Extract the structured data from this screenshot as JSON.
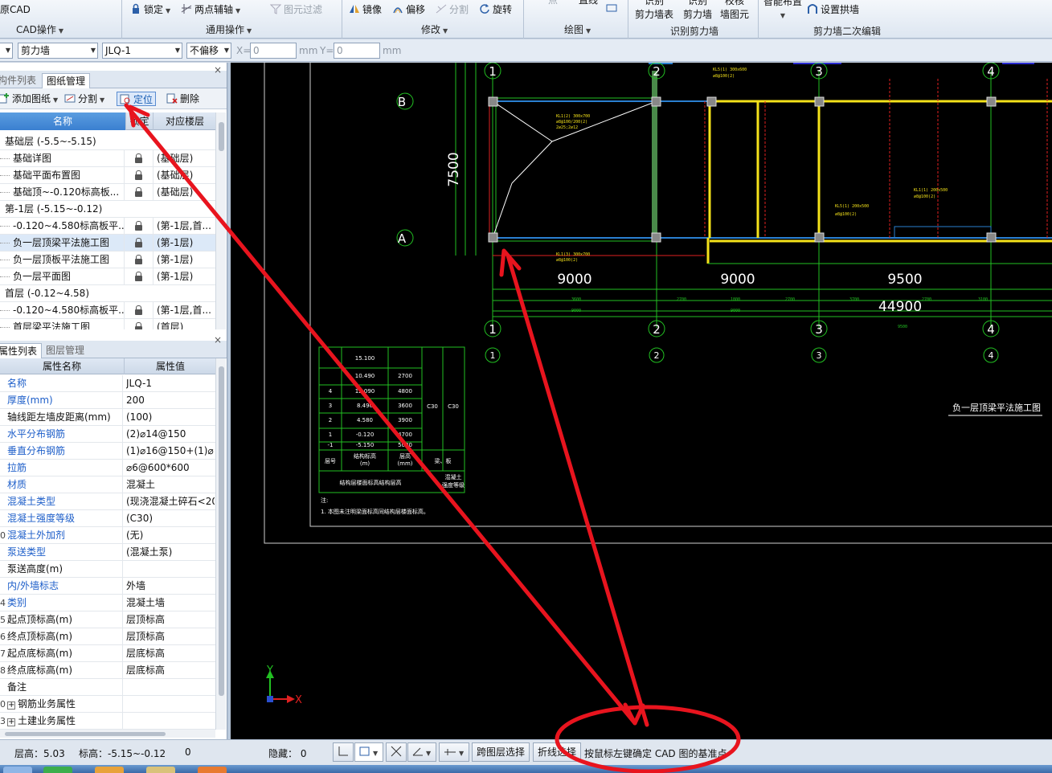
{
  "ribbon": {
    "cad_title": "原CAD",
    "cad_ops": "CAD操作",
    "lock": "锁定",
    "two_point_axis": "两点辅轴",
    "element_filter": "图元过滤",
    "general_ops": "通用操作",
    "mirror": "镜像",
    "offset": "偏移",
    "split": "分割",
    "rotate": "旋转",
    "modify": "修改",
    "point": "点",
    "line": "直线",
    "draw": "绘图",
    "identify_table": "识别\n剪力墙表",
    "identify_wall": "识别\n剪力墙",
    "check_element": "校核\n墙图元",
    "identify_group": "识别剪力墙",
    "smart_layout": "智能布置",
    "set_arch": "设置拱墙",
    "wall_edit": "剪力墙二次编辑"
  },
  "toolbar": {
    "combo0": "",
    "type": "剪力墙",
    "name": "JLQ-1",
    "offset_mode": "不偏移",
    "x_label": "X=",
    "x_value": "0",
    "unit1": "mm",
    "y_label": "Y=",
    "y_value": "0",
    "unit2": "mm"
  },
  "drawing_panel": {
    "tab_components": "构件列表",
    "tab_drawings": "图纸管理",
    "add_drawing": "添加图纸",
    "split": "分割",
    "locate": "定位",
    "delete": "删除",
    "col_name": "名称",
    "col_lock": "锁定",
    "col_floor": "对应楼层",
    "rows": [
      {
        "type": "group",
        "name": "基础层 (-5.5~-5.15)"
      },
      {
        "type": "item",
        "name": "基础详图",
        "floor": "(基础层)"
      },
      {
        "type": "item",
        "name": "基础平面布置图",
        "floor": "(基础层)"
      },
      {
        "type": "item",
        "name": "基础顶~-0.120标高板...",
        "floor": "(基础层)"
      },
      {
        "type": "group",
        "name": "第-1层 (-5.15~-0.12)"
      },
      {
        "type": "item",
        "name": "-0.120~4.580标高板平...",
        "floor": "(第-1层,首..."
      },
      {
        "type": "item",
        "name": "负一层顶梁平法施工图",
        "floor": "(第-1层)"
      },
      {
        "type": "item",
        "name": "负一层顶板平法施工图",
        "floor": "(第-1层)"
      },
      {
        "type": "item",
        "name": "负一层平面图",
        "floor": "(第-1层)"
      },
      {
        "type": "group",
        "name": "首层 (-0.12~4.58)"
      },
      {
        "type": "item",
        "name": "-0.120~4.580标高板平...",
        "floor": "(第-1层,首..."
      },
      {
        "type": "item",
        "name": "首层梁平法施工图",
        "floor": "(首层)"
      }
    ]
  },
  "property_panel": {
    "tab_props": "属性列表",
    "tab_layers": "图层管理",
    "col_name": "属性名称",
    "col_value": "属性值",
    "rows": [
      {
        "idx": "",
        "name": "名称",
        "value": "JLQ-1",
        "blue": true
      },
      {
        "idx": "",
        "name": "厚度(mm)",
        "value": "200",
        "blue": true
      },
      {
        "idx": "",
        "name": "轴线距左墙皮距离(mm)",
        "value": "(100)",
        "blue": false
      },
      {
        "idx": "",
        "name": "水平分布钢筋",
        "value": "(2)⌀14@150",
        "blue": true
      },
      {
        "idx": "",
        "name": "垂直分布钢筋",
        "value": "(1)⌀16@150+(1)⌀",
        "blue": true
      },
      {
        "idx": "",
        "name": "拉筋",
        "value": "⌀6@600*600",
        "blue": true
      },
      {
        "idx": "",
        "name": "材质",
        "value": "混凝土",
        "blue": true
      },
      {
        "idx": "",
        "name": "混凝土类型",
        "value": "(现浇混凝土碎石<20",
        "blue": true
      },
      {
        "idx": "",
        "name": "混凝土强度等级",
        "value": "(C30)",
        "blue": true
      },
      {
        "idx": "0",
        "name": "混凝土外加剂",
        "value": "(无)",
        "blue": true
      },
      {
        "idx": "",
        "name": "泵送类型",
        "value": "(混凝土泵)",
        "blue": true
      },
      {
        "idx": "",
        "name": "泵送高度(m)",
        "value": "",
        "blue": false
      },
      {
        "idx": "",
        "name": "内/外墙标志",
        "value": "外墙",
        "blue": true
      },
      {
        "idx": "4",
        "name": "类别",
        "value": "混凝土墙",
        "blue": true
      },
      {
        "idx": "5",
        "name": "起点顶标高(m)",
        "value": "层顶标高",
        "blue": false
      },
      {
        "idx": "6",
        "name": "终点顶标高(m)",
        "value": "层顶标高",
        "blue": false
      },
      {
        "idx": "7",
        "name": "起点底标高(m)",
        "value": "层底标高",
        "blue": false
      },
      {
        "idx": "8",
        "name": "终点底标高(m)",
        "value": "层底标高",
        "blue": false
      },
      {
        "idx": "",
        "name": "备注",
        "value": "",
        "blue": false
      },
      {
        "idx": "0",
        "name": "钢筋业务属性",
        "value": "",
        "blue": false,
        "expander": true
      },
      {
        "idx": "3",
        "name": "土建业务属性",
        "value": "",
        "blue": false,
        "expander": true
      }
    ]
  },
  "drawing": {
    "axes_top": [
      "1",
      "2",
      "3",
      "4"
    ],
    "axes_left": [
      "B",
      "A"
    ],
    "dim_7500": "7500",
    "dim_9000a": "9000",
    "dim_9000b": "9000",
    "dim_9500": "9500",
    "dim_total": "44900",
    "drawing_title": "负一层顶梁平法施工图",
    "table_rows": [
      [
        "",
        "15.100",
        "",
        "",
        ""
      ],
      [
        "",
        "10.490",
        "2700",
        "",
        ""
      ],
      [
        "4",
        "12.090",
        "4800",
        "",
        ""
      ],
      [
        "3",
        "8.490",
        "3600",
        "C30",
        "C30"
      ],
      [
        "2",
        "4.580",
        "3900",
        "",
        ""
      ],
      [
        "1",
        "-0.120",
        "4700",
        "",
        ""
      ],
      [
        "-1",
        "-5.150",
        "5000",
        "",
        ""
      ]
    ],
    "table_footer_left": "层号",
    "table_footer_mid1": "结构标高\n(m)",
    "table_footer_mid2": "层高\n(mm)",
    "table_footer_right": "梁、板",
    "table_caption": "结构层楼面标高结构层高",
    "table_caption2": "混凝土\n强度等级",
    "note_label": "注:",
    "note_text": "1. 本图未注明梁面标高同结构层楼面标高。"
  },
  "status": {
    "floor_height": "层高：5.03",
    "elevation": "标高：-5.15~-0.12",
    "count": "0",
    "hidden": "隐藏： 0",
    "cross_layer": "跨图层选择",
    "polyline": "折线选择",
    "hint": "按鼠标左键确定 CAD 图的基准点"
  },
  "colors": {
    "annotation_red": "#e8141e",
    "accent_blue": "#1d5ec9"
  }
}
